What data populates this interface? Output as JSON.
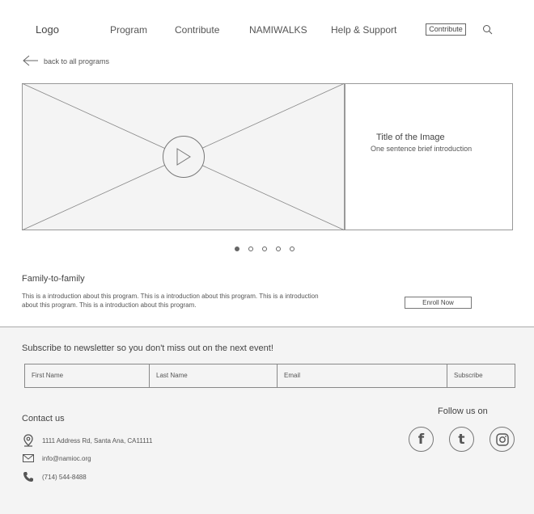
{
  "header": {
    "logo": "Logo",
    "nav": [
      "Program",
      "Contribute",
      "NAMIWALKS",
      "Help & Support"
    ],
    "cta_label": "Contribute"
  },
  "back_link": "back to all programs",
  "hero": {
    "title": "Title of the Image",
    "subtitle": "One sentence brief introduction",
    "slides": 5,
    "active_slide": 1
  },
  "program": {
    "title": "Family-to-family",
    "description": "This is a introduction about this program.  This is a introduction about this program. This is a introduction about this program. This is a introduction about this program.",
    "enroll_label": "Enroll Now"
  },
  "newsletter": {
    "heading": "Subscribe to newsletter so you don't miss out on the next event!",
    "first_name": "First Name",
    "last_name": "Last Name",
    "email": "Email",
    "subscribe_label": "Subscribe"
  },
  "contact": {
    "heading": "Contact us",
    "address": "1111 Address Rd, Santa Ana, CA11111",
    "email": "info@namioc.org",
    "phone": "(714) 544-8488"
  },
  "social": {
    "heading": "Follow us on",
    "icons": [
      "facebook-icon",
      "tumblr-icon",
      "instagram-icon"
    ]
  }
}
